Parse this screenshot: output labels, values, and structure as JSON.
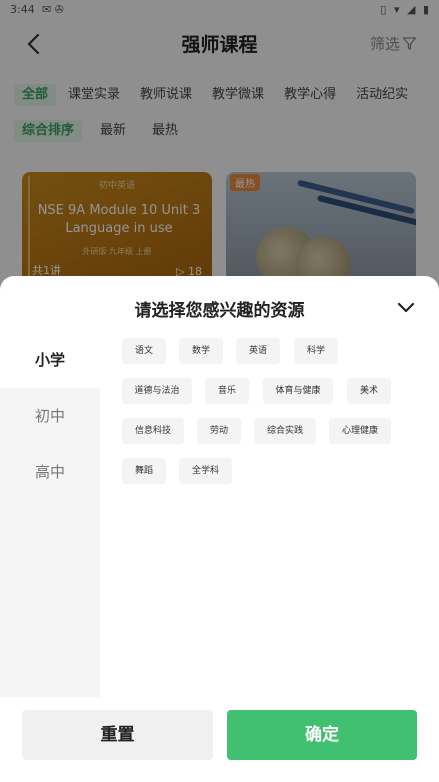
{
  "status_bar": {
    "time": "3:44",
    "left_icons": "✉ ✇",
    "right_icons": "▯ ▾ ◢ ▮"
  },
  "header": {
    "title": "强师课程",
    "filter_label": "筛选"
  },
  "category_tabs": [
    {
      "label": "全部",
      "active": true
    },
    {
      "label": "课堂实录",
      "active": false
    },
    {
      "label": "教师说课",
      "active": false
    },
    {
      "label": "教学微课",
      "active": false
    },
    {
      "label": "教学心得",
      "active": false
    },
    {
      "label": "活动纪实",
      "active": false
    }
  ],
  "sort_tabs": [
    {
      "label": "综合排序",
      "active": true
    },
    {
      "label": "最新",
      "active": false
    },
    {
      "label": "最热",
      "active": false
    }
  ],
  "cards": [
    {
      "brand": "初中英语",
      "title": "NSE 9A Module 10 Unit 3 Language in use",
      "sub": "外研版 九年级 上册",
      "lessons": "共1讲",
      "views": "▷ 18"
    },
    {
      "badge": "最热"
    }
  ],
  "sheet": {
    "title": "请选择您感兴趣的资源",
    "levels": [
      {
        "label": "小学",
        "active": true
      },
      {
        "label": "初中",
        "active": false
      },
      {
        "label": "高中",
        "active": false
      }
    ],
    "subjects": [
      [
        "语文",
        "数学",
        "英语",
        "科学"
      ],
      [
        "道德与法治",
        "音乐",
        "体育与健康",
        "美术"
      ],
      [
        "信息科技",
        "劳动",
        "综合实践",
        "心理健康"
      ],
      [
        "舞蹈",
        "全学科"
      ]
    ],
    "reset_label": "重置",
    "confirm_label": "确定"
  },
  "colors": {
    "accent": "#40c070",
    "active_tab_bg": "#dff1e6",
    "active_tab_text": "#3c9e63"
  }
}
